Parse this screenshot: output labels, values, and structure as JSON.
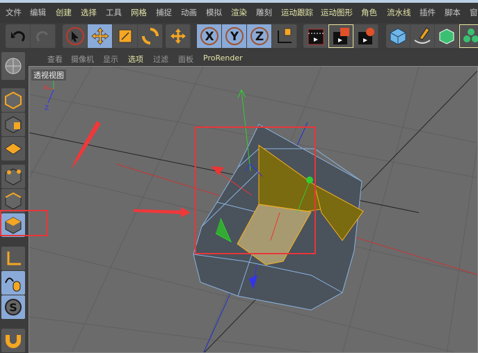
{
  "menu": {
    "items": [
      "文件",
      "编辑",
      "创建",
      "选择",
      "工具",
      "网格",
      "捕捉",
      "动画",
      "模拟",
      "渲染",
      "雕刻",
      "运动跟踪",
      "运动图形",
      "角色",
      "流水线",
      "插件",
      "脚本",
      "窗"
    ]
  },
  "toolbar": {
    "groups": [
      [
        "undo-icon",
        "redo-icon"
      ],
      [
        "live-select-icon",
        "move-icon",
        "scale-icon",
        "rotate-icon"
      ],
      [
        "move-alt-icon"
      ],
      [
        "x-axis-icon",
        "y-axis-icon",
        "z-axis-icon",
        "world-coordinates-icon"
      ],
      [
        "render-view-icon",
        "render-picture-viewer-icon",
        "render-settings-icon"
      ],
      [
        "cube-icon",
        "pen-icon",
        "subdivision-icon",
        "cloner-icon"
      ]
    ],
    "active": [
      "move-icon",
      "x-axis-icon",
      "y-axis-icon",
      "z-axis-icon"
    ]
  },
  "viewport_menu": {
    "items": [
      "查看",
      "摄像机",
      "显示",
      "选项",
      "过滤",
      "面板",
      "ProRender"
    ]
  },
  "viewport": {
    "title": "透视视图",
    "axis_labels": {
      "x": "X",
      "y": "Y",
      "z": "Z"
    }
  },
  "left_panel": {
    "tools": [
      "make-editable-icon",
      "model-mode-icon",
      "texture-mode-icon",
      "workplane-icon",
      "point-mode-icon",
      "edge-mode-icon",
      "polygon-mode-icon",
      "axis-mode-icon",
      "tweak-mode-icon",
      "solo-icon",
      "snap-icon"
    ],
    "active": "polygon-mode-icon"
  },
  "colors": {
    "selection": "#e8a020",
    "annotation": "#e8363a",
    "active_button": "#8aaad8"
  }
}
